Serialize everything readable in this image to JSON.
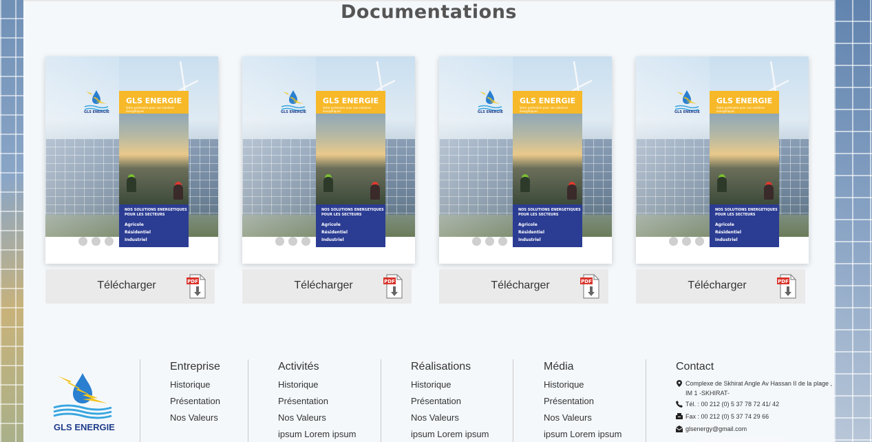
{
  "page": {
    "title": "Documentations"
  },
  "documents": [
    {
      "brochure": {
        "brand": "GLS ENERGIE",
        "tagline": "Votre partenaire pour vos solutions énergétiques",
        "heading": "NOS SOLUTIONS ENERGETIQUES POUR LES SECTEURS",
        "sectors": [
          "Agricole",
          "Résidentiel",
          "Industriel"
        ]
      },
      "download_label": "Télécharger",
      "icon": "pdf-download-icon"
    },
    {
      "brochure": {
        "brand": "GLS ENERGIE",
        "tagline": "Votre partenaire pour vos solutions énergétiques",
        "heading": "NOS SOLUTIONS ENERGETIQUES POUR LES SECTEURS",
        "sectors": [
          "Agricole",
          "Résidentiel",
          "Industriel"
        ]
      },
      "download_label": "Télécharger",
      "icon": "pdf-download-icon"
    },
    {
      "brochure": {
        "brand": "GLS ENERGIE",
        "tagline": "Votre partenaire pour vos solutions énergétiques",
        "heading": "NOS SOLUTIONS ENERGETIQUES POUR LES SECTEURS",
        "sectors": [
          "Agricole",
          "Résidentiel",
          "Industriel"
        ]
      },
      "download_label": "Télécharger",
      "icon": "pdf-download-icon"
    },
    {
      "brochure": {
        "brand": "GLS ENERGIE",
        "tagline": "Votre partenaire pour vos solutions énergétiques",
        "heading": "NOS SOLUTIONS ENERGETIQUES POUR LES SECTEURS",
        "sectors": [
          "Agricole",
          "Résidentiel",
          "Industriel"
        ]
      },
      "download_label": "Télécharger",
      "icon": "pdf-download-icon"
    }
  ],
  "footer": {
    "logo_text": "GLS ENERGIE",
    "columns": [
      {
        "title": "Entreprise",
        "links": [
          "Historique",
          "Présentation",
          "Nos Valeurs"
        ]
      },
      {
        "title": "Activités",
        "links": [
          "Historique",
          "Présentation",
          "Nos Valeurs",
          "ipsum Lorem ipsum"
        ]
      },
      {
        "title": "Réalisations",
        "links": [
          "Historique",
          "Présentation",
          "Nos Valeurs",
          "ipsum Lorem ipsum"
        ]
      },
      {
        "title": "Média",
        "links": [
          "Historique",
          "Présentation",
          "Nos Valeurs",
          "ipsum Lorem ipsum"
        ]
      }
    ],
    "contact": {
      "title": "Contact",
      "address": "Complexe de Skhirat Angle Av Hassan II de la plage , IM 1 -SKHIRAT-",
      "phone": "Tél. : 00 212 (0) 5 37 78 72 41/ 42",
      "fax": "Fax : 00 212 (0) 5 37 74 29 66",
      "email": "glsenergy@gmail.com"
    }
  },
  "colors": {
    "brand_blue": "#2b3c93",
    "brand_yellow": "#f7b929",
    "pdf_red": "#d9342b"
  }
}
